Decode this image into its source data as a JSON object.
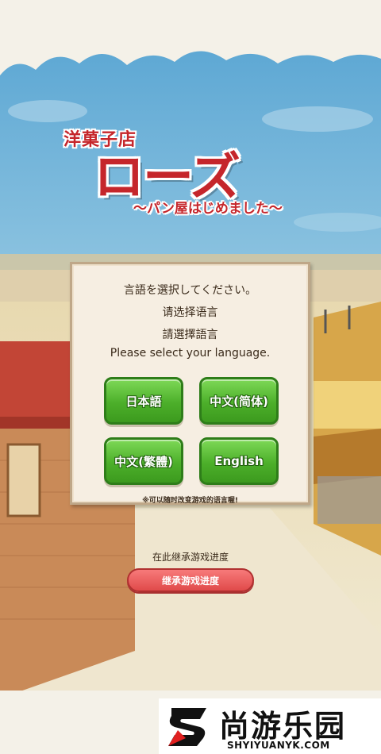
{
  "logo": {
    "small": "洋菓子店",
    "big": "ローズ",
    "sub": "〜パン屋はじめました〜"
  },
  "language_dialog": {
    "prompts": [
      "言語を選択してください。",
      "请选择语言",
      "請選擇語言",
      "Please select your language."
    ],
    "buttons": [
      "日本語",
      "中文(简体)",
      "中文(繁體)",
      "English"
    ],
    "note": "※可以随时改变游戏的语言喔!"
  },
  "continue": {
    "label": "在此继承游戏进度",
    "button": "继承游戏进度"
  },
  "watermark": {
    "name": "尚游乐园",
    "url": "SHYIYUANYK.COM"
  },
  "colors": {
    "title_red": "#c5262b",
    "button_green": "#4caf2a",
    "continue_red": "#e04a4a",
    "sky": "#6fb2d8"
  }
}
